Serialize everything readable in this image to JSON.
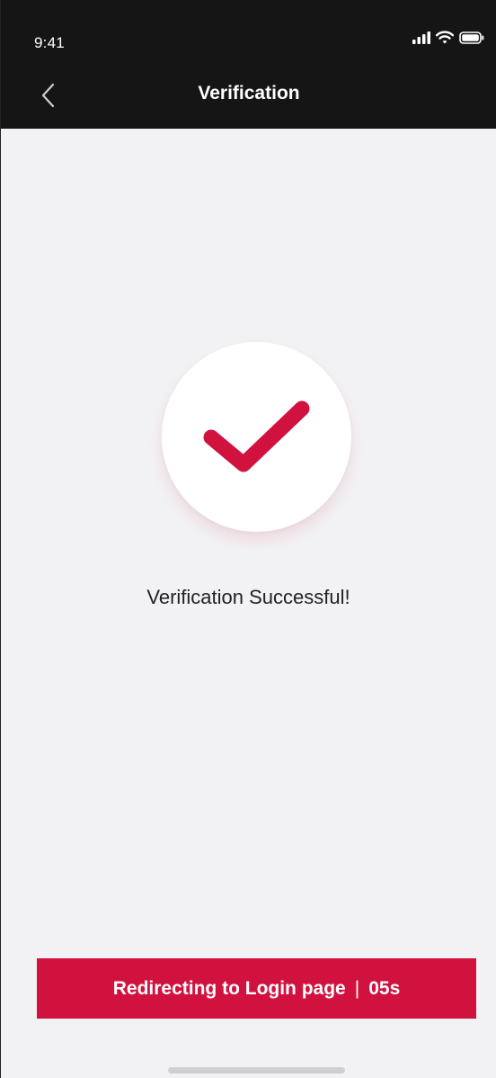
{
  "status_bar": {
    "time": "9:41",
    "icons": [
      "signal-icon",
      "wifi-icon",
      "battery-icon"
    ]
  },
  "nav": {
    "title": "Verification",
    "back_icon": "chevron-left-icon"
  },
  "main": {
    "icon": "checkmark-icon",
    "message": "Verification Successful!"
  },
  "redirect": {
    "label": "Redirecting to Login page",
    "separator": "|",
    "countdown": "05s"
  },
  "colors": {
    "accent": "#d1123f",
    "header_bg": "#151515",
    "page_bg": "#f2f2f5"
  }
}
